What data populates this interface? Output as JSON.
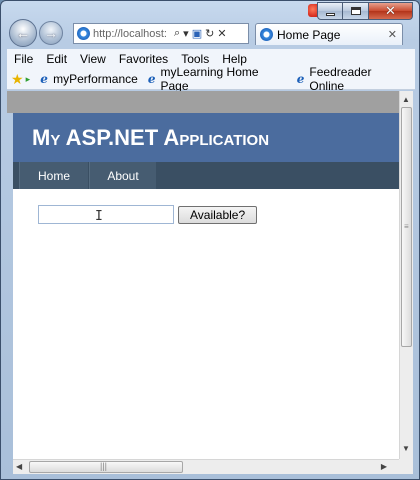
{
  "browser": {
    "address": "http://localhost:",
    "address_icons": {
      "search": "⌕",
      "dropdown": "▾",
      "compat": "▣",
      "refresh": "↻",
      "stop": "✕"
    },
    "tab": {
      "title": "Home Page",
      "close": "✕"
    },
    "caption": {
      "close": "✕"
    },
    "menu": [
      "File",
      "Edit",
      "View",
      "Favorites",
      "Tools",
      "Help"
    ],
    "favorites": [
      "myPerformance",
      "myLearning Home Page",
      "Feedreader Online"
    ],
    "icons": {
      "back": "←",
      "forward": "→",
      "star": "★",
      "add_favorite": "▸",
      "ie": "e"
    },
    "scroll_icons": {
      "up": "▲",
      "down": "▼",
      "left": "◀",
      "right": "▶",
      "v_grip": "≡",
      "h_grip": "|||"
    }
  },
  "page": {
    "title": "My ASP.NET Application",
    "nav": [
      "Home",
      "About"
    ],
    "input": {
      "value": "",
      "placeholder": ""
    },
    "button_label": "Available?",
    "cursor": "I"
  },
  "colors": {
    "header_bg": "#4b6c9e",
    "nav_bg": "#465c71",
    "nav_bar_bg": "#3a4f63"
  }
}
